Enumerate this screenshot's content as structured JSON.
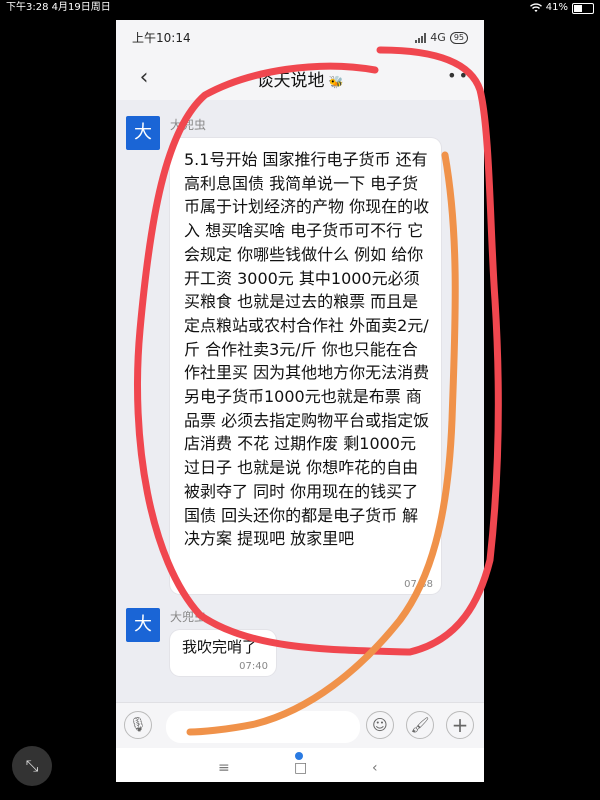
{
  "outer_status": {
    "time_date": "下午3:28  4月19日周日",
    "battery": "41%"
  },
  "phone": {
    "status": {
      "time": "上午10:14",
      "network": "4G",
      "battery": "95"
    },
    "title": "谈天说地",
    "title_emoji": "🐝",
    "back_label": "‹",
    "more_label": "••",
    "messages": [
      {
        "avatar": "大",
        "sender": "大兜虫",
        "text": "5.1号开始 国家推行电子货币 还有高利息国债 我简单说一下 电子货币属于计划经济的产物 你现在的收入 想买啥买啥 电子货币可不行 它会规定 你哪些钱做什么 例如 给你开工资 3000元 其中1000元必须买粮食 也就是过去的粮票 而且是定点粮站或农村合作社 外面卖2元/斤 合作社卖3元/斤 你也只能在合作社里买 因为其他地方你无法消费 另电子货币1000元也就是布票 商品票 必须去指定购物平台或指定饭店消费 不花 过期作废 剩1000元过日子 也就是说 你想咋花的自由被剥夺了 同时 你用现在的钱买了国债 回头还你的都是电子货币 解决方案 提现吧 放家里吧",
        "time": "07:38"
      },
      {
        "avatar": "大",
        "sender": "大兜虫",
        "text": "我吹完哨了",
        "time": "07:40"
      }
    ],
    "icons": {
      "voice": "🎙",
      "emoji": "☺",
      "brush": "🖌",
      "plus": "+"
    },
    "nav": {
      "menu": "≡",
      "home": "□",
      "back": "‹"
    }
  },
  "expand_icon": "⤡",
  "colors": {
    "avatar": "#1a65d6",
    "red_annotation": "#f0474f",
    "orange_annotation": "#f0924a"
  }
}
